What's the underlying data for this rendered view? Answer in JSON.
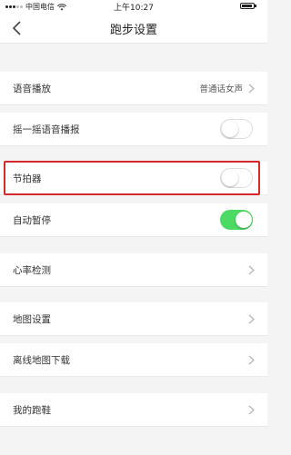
{
  "status_bar": {
    "carrier": "中国电信",
    "time": "上午10:27",
    "battery_level": 0.9
  },
  "nav": {
    "title": "跑步设置"
  },
  "settings": [
    {
      "label": "语音播放",
      "value": "普通话女声",
      "control": "chevron"
    },
    {
      "label": "摇一摇语音播报",
      "control": "toggle",
      "on": false
    },
    {
      "label": "节拍器",
      "control": "toggle",
      "on": false,
      "highlighted": true
    },
    {
      "label": "自动暂停",
      "control": "toggle",
      "on": true
    },
    {
      "label": "心率检测",
      "control": "chevron"
    },
    {
      "label": "地图设置",
      "control": "chevron"
    },
    {
      "label": "离线地图下载",
      "control": "chevron"
    },
    {
      "label": "我的跑鞋",
      "control": "chevron"
    }
  ],
  "colors": {
    "toggle_on": "#4cd964",
    "highlight_border": "#d22a2a"
  }
}
